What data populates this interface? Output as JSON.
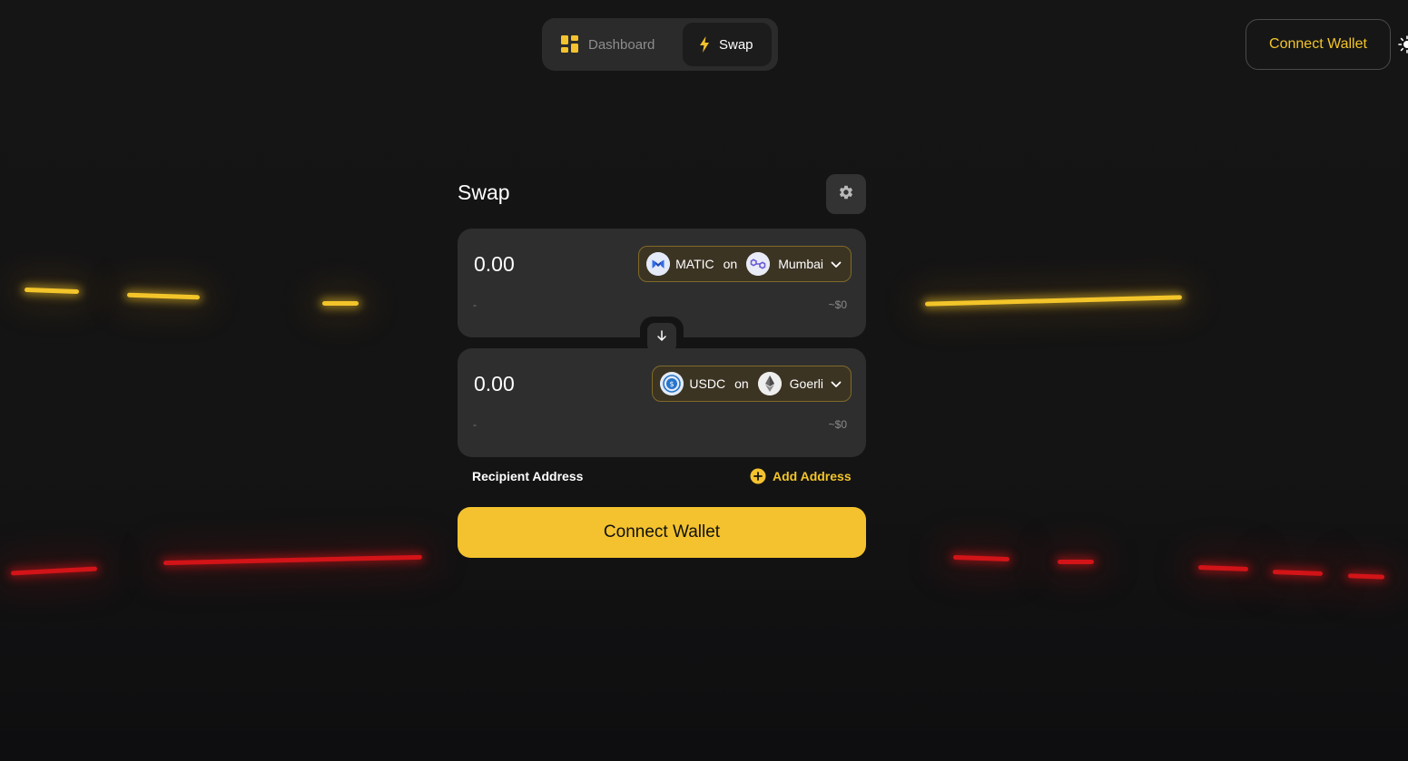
{
  "nav": {
    "tabs": [
      {
        "label": "Dashboard",
        "icon": "dashboard-grid-icon",
        "active": false
      },
      {
        "label": "Swap",
        "icon": "lightning-icon",
        "active": true
      }
    ]
  },
  "header": {
    "connect_label": "Connect Wallet",
    "theme_icon": "sun-icon"
  },
  "swap": {
    "title": "Swap",
    "settings_icon": "gear-icon",
    "from": {
      "amount_placeholder": "0.00",
      "token": "MATIC",
      "on": "on",
      "chain": "Mumbai",
      "sub_left": "-",
      "usd_value": "~$0"
    },
    "to": {
      "amount_placeholder": "0.00",
      "token": "USDC",
      "on": "on",
      "chain": "Goerli",
      "sub_left": "-",
      "usd_value": "~$0"
    },
    "recipient_label": "Recipient Address",
    "add_address_label": "Add Address",
    "connect_label": "Connect Wallet"
  },
  "colors": {
    "accent": "#f3c22e",
    "background": "#141414",
    "panel": "#2e2e2e"
  }
}
